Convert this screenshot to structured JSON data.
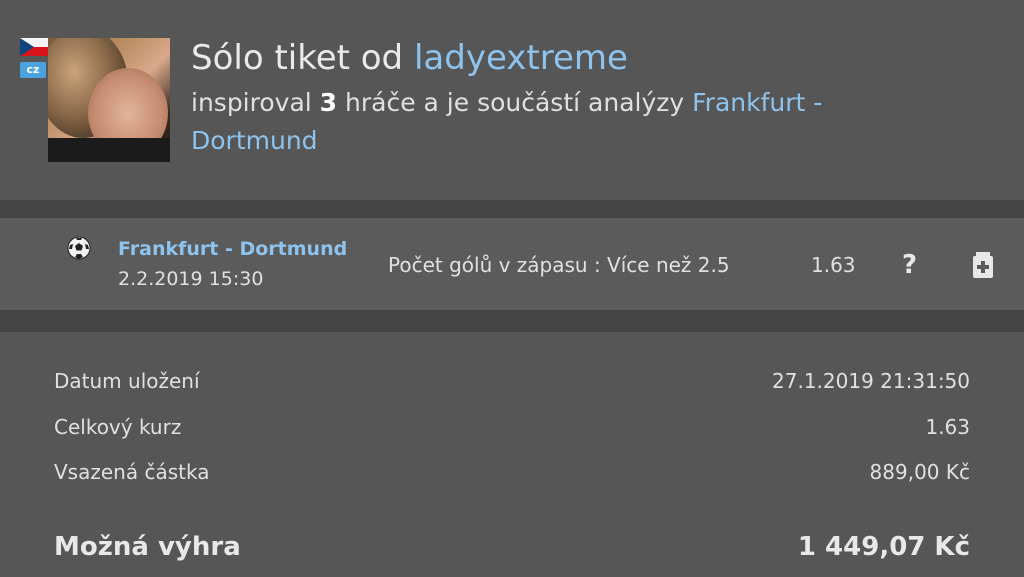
{
  "header": {
    "flag_icon": "czech-flag-icon",
    "tld_badge": "cz",
    "title_prefix": "Sólo tiket od ",
    "username": "ladyextreme",
    "subtitle_before": "inspiroval ",
    "inspired_count": "3",
    "subtitle_middle": " hráče a je součástí analýzy ",
    "analysis_link": "Frankfurt - Dortmund"
  },
  "bet": {
    "sport_icon": "football-icon",
    "match": "Frankfurt - Dortmund",
    "datetime": "2.2.2019 15:30",
    "market": "Počet gólů v zápasu : Více než 2.5",
    "odd": "1.63",
    "help": "?",
    "add_icon": "add-to-ticket-icon"
  },
  "summary": {
    "saved_label": "Datum uložení",
    "saved_value": "27.1.2019 21:31:50",
    "total_odds_label": "Celkový kurz",
    "total_odds_value": "1.63",
    "stake_label": "Vsazená částka",
    "stake_value": "889,00 Kč",
    "possible_win_label": "Možná výhra",
    "possible_win_value": "1 449,07 Kč"
  },
  "colors": {
    "background": "#565656",
    "separator": "#444444",
    "link": "#8ec3ee",
    "text": "#e0e0e0"
  }
}
